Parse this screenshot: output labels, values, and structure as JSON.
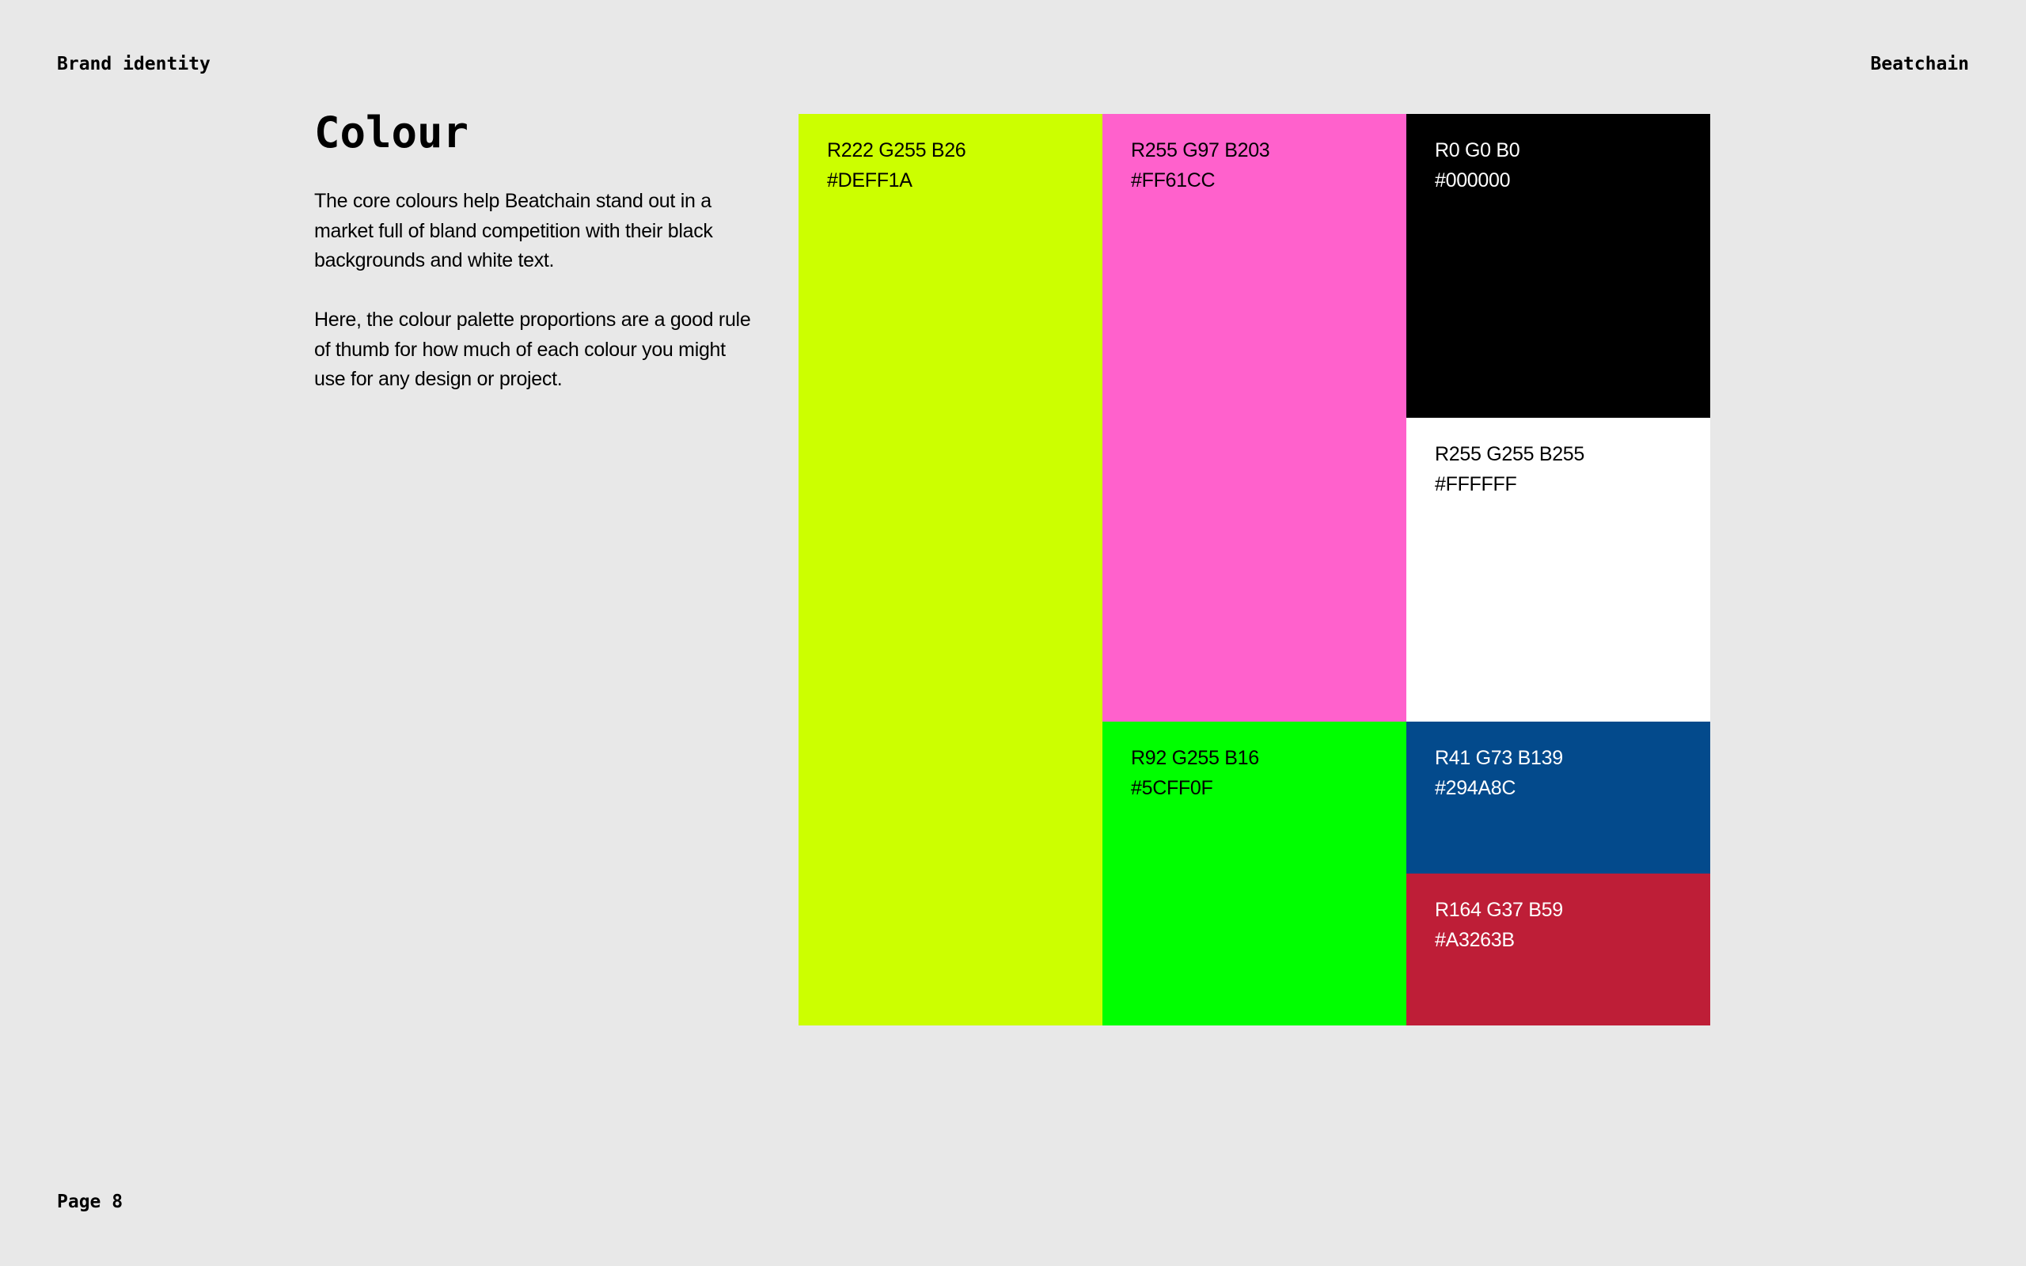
{
  "header": {
    "left": "Brand identity",
    "right": "Beatchain"
  },
  "title": "Colour",
  "intro": {
    "p1": "The core colours help Beatchain stand out in a market full of bland competition with their black backgrounds and white text.",
    "p2": "Here, the colour palette proportions are a good rule of thumb for how much of each colour you might use for any design or project."
  },
  "palette": {
    "lime": {
      "rgb": "R222 G255 B26",
      "hex": "#DEFF1A",
      "fill": "#CCFF00",
      "text_color": "#000000"
    },
    "pink": {
      "rgb": "R255 G97 B203",
      "hex": "#FF61CC",
      "fill": "#FF61CC",
      "text_color": "#000000"
    },
    "black": {
      "rgb": "R0 G0 B0",
      "hex": "#000000",
      "fill": "#000000",
      "text_color": "#FFFFFF"
    },
    "white": {
      "rgb": "R255 G255 B255",
      "hex": "#FFFFFF",
      "fill": "#FFFFFF",
      "text_color": "#000000"
    },
    "green": {
      "rgb": "R92 G255 B16",
      "hex": "#5CFF0F",
      "fill": "#00FF00",
      "text_color": "#000000"
    },
    "blue": {
      "rgb": "R41 G73 B139",
      "hex": "#294A8C",
      "fill": "#034A8C",
      "text_color": "#FFFFFF"
    },
    "red": {
      "rgb": "R164 G37 B59",
      "hex": "#A3263B",
      "fill": "#BE1E37",
      "text_color": "#FFFFFF"
    }
  },
  "footer": {
    "page": "Page 8"
  }
}
